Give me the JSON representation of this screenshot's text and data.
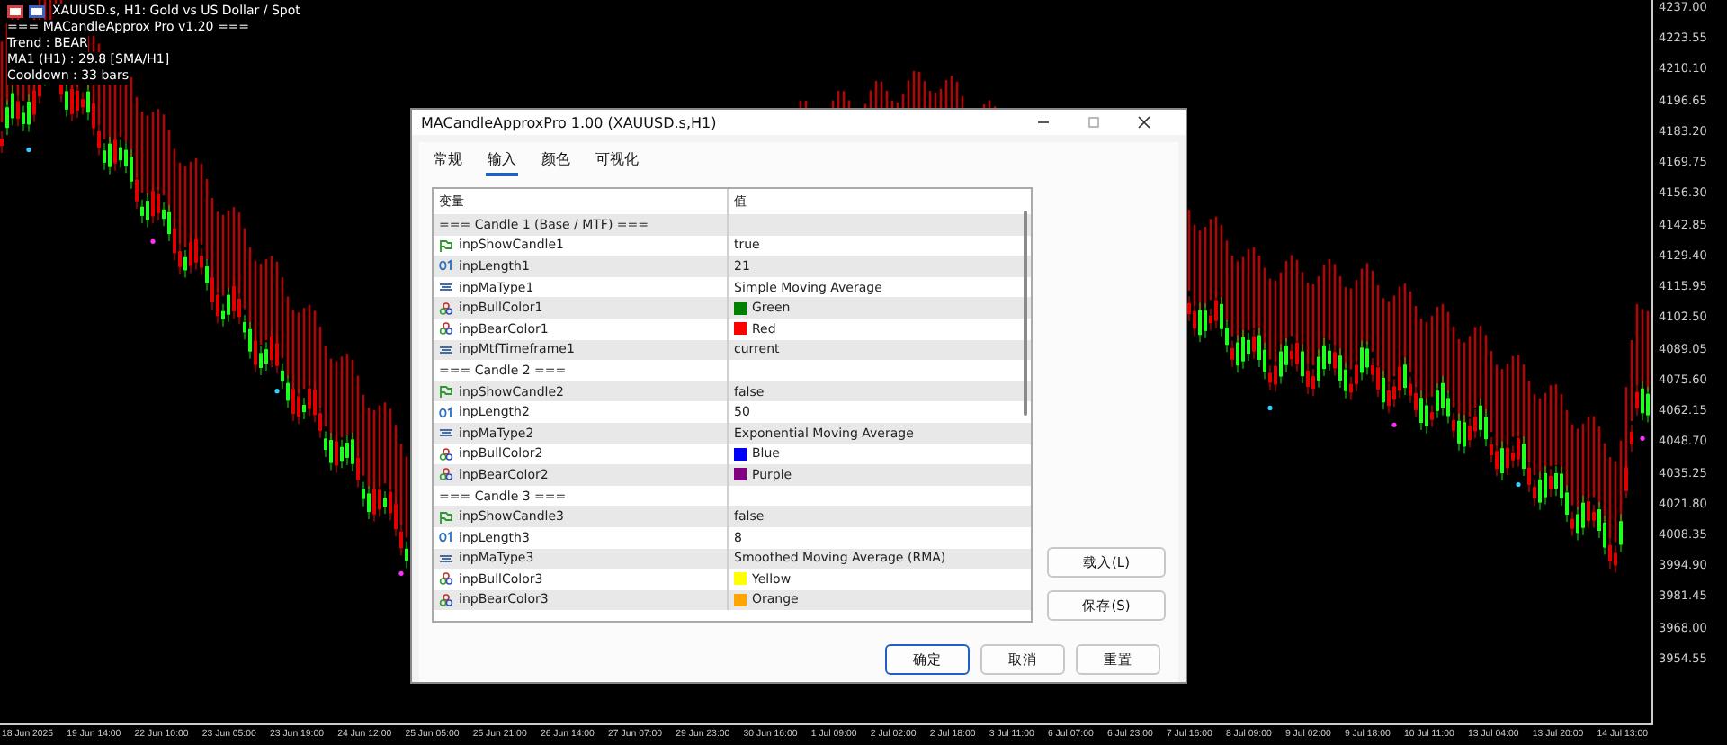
{
  "chart": {
    "overlay": [
      "XAUUSD.s, H1:  Gold vs US Dollar / Spot",
      "=== MACandleApprox Pro v1.20 ===",
      "Trend : BEAR",
      "MA1 (H1) : 29.8  [SMA/H1]",
      "Cooldown : 33 bars"
    ],
    "price_axis": [
      "4237.00",
      "4223.55",
      "4210.10",
      "4196.65",
      "4183.20",
      "4169.75",
      "4156.30",
      "4142.85",
      "4129.40",
      "4115.95",
      "4102.50",
      "4089.05",
      "4075.60",
      "4062.15",
      "4048.70",
      "4035.25",
      "4021.80",
      "4008.35",
      "3994.90",
      "3981.45",
      "3968.00",
      "3954.55"
    ],
    "time_axis": [
      "18 Jun 2025",
      "19 Jun 14:00",
      "22 Jun 10:00",
      "23 Jun 05:00",
      "23 Jun 19:00",
      "24 Jun 12:00",
      "25 Jun 05:00",
      "25 Jun 21:00",
      "26 Jun 14:00",
      "27 Jun 07:00",
      "29 Jun 23:00",
      "30 Jun 16:00",
      "1 Jul 09:00",
      "2 Jul 02:00",
      "2 Jul 18:00",
      "3 Jul 11:00",
      "6 Jul 07:00",
      "6 Jul 23:00",
      "7 Jul 16:00",
      "8 Jul 09:00",
      "9 Jul 02:00",
      "9 Jul 18:00",
      "10 Jul 11:00",
      "13 Jul 04:00",
      "13 Jul 20:00",
      "14 Jul 13:00"
    ]
  },
  "dialog": {
    "title": "MACandleApproxPro 1.00 (XAUUSD.s,H1)",
    "tabs": [
      {
        "label": "常规",
        "selected": false
      },
      {
        "label": "输入",
        "selected": true
      },
      {
        "label": "颜色",
        "selected": false
      },
      {
        "label": "可视化",
        "selected": false
      }
    ],
    "columns": [
      "变量",
      "值"
    ],
    "rows": [
      {
        "kind": "group",
        "name": "=== Candle 1 (Base / MTF) ==="
      },
      {
        "kind": "bool",
        "name": "inpShowCandle1",
        "value": "true"
      },
      {
        "kind": "int",
        "name": "inpLength1",
        "value": "21"
      },
      {
        "kind": "enum",
        "name": "inpMaType1",
        "value": "Simple Moving Average"
      },
      {
        "kind": "color",
        "name": "inpBullColor1",
        "value": "Green",
        "color": "#008000"
      },
      {
        "kind": "color",
        "name": "inpBearColor1",
        "value": "Red",
        "color": "#ff0000"
      },
      {
        "kind": "enum",
        "name": "inpMtfTimeframe1",
        "value": "current"
      },
      {
        "kind": "group",
        "name": "=== Candle 2 ==="
      },
      {
        "kind": "bool",
        "name": "inpShowCandle2",
        "value": "false"
      },
      {
        "kind": "int",
        "name": "inpLength2",
        "value": "50"
      },
      {
        "kind": "enum",
        "name": "inpMaType2",
        "value": "Exponential Moving Average"
      },
      {
        "kind": "color",
        "name": "inpBullColor2",
        "value": "Blue",
        "color": "#0000ff"
      },
      {
        "kind": "color",
        "name": "inpBearColor2",
        "value": "Purple",
        "color": "#800080"
      },
      {
        "kind": "group",
        "name": "=== Candle 3 ==="
      },
      {
        "kind": "bool",
        "name": "inpShowCandle3",
        "value": "false"
      },
      {
        "kind": "int",
        "name": "inpLength3",
        "value": "8"
      },
      {
        "kind": "enum",
        "name": "inpMaType3",
        "value": "Smoothed Moving Average (RMA)"
      },
      {
        "kind": "color",
        "name": "inpBullColor3",
        "value": "Yellow",
        "color": "#ffff00"
      },
      {
        "kind": "color",
        "name": "inpBearColor3",
        "value": "Orange",
        "color": "#ffa500"
      }
    ],
    "side_buttons": [
      "载入(L)",
      "保存(S)"
    ],
    "buttons": [
      {
        "label": "确定",
        "primary": true
      },
      {
        "label": "取消",
        "primary": false
      },
      {
        "label": "重置",
        "primary": false
      }
    ]
  }
}
